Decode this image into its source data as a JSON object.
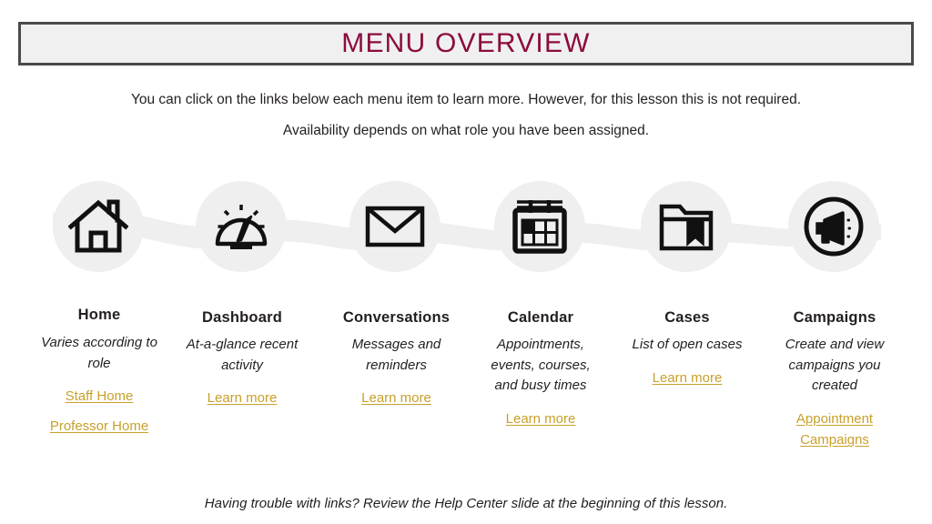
{
  "title": {
    "text": "MENU OVERVIEW",
    "color": "#8c0b3f",
    "banner_fill": "#f0f0f0",
    "banner_border": "#4a4a4a"
  },
  "intro": {
    "line1": "You can click on the links below each menu item to learn more. However, for this lesson this is not required.",
    "line2": "Availability depends on what role you have been assigned."
  },
  "icon_band": {
    "fill": "#efefef",
    "icons": [
      {
        "name": "home-icon"
      },
      {
        "name": "dashboard-gauge-icon"
      },
      {
        "name": "envelope-icon"
      },
      {
        "name": "calendar-icon"
      },
      {
        "name": "folder-bookmark-icon"
      },
      {
        "name": "megaphone-circle-icon"
      }
    ]
  },
  "columns": [
    {
      "id": "home",
      "title": "Home",
      "description": "Varies according to role",
      "links": [
        "Staff Home",
        "Professor Home"
      ]
    },
    {
      "id": "dashboard",
      "title": "Dashboard",
      "description": "At-a-glance recent activity",
      "links": [
        "Learn more"
      ]
    },
    {
      "id": "conversations",
      "title": "Conversations",
      "description": "Messages and reminders",
      "links": [
        "Learn more"
      ]
    },
    {
      "id": "calendar",
      "title": "Calendar",
      "description": "Appointments, events, courses, and busy times",
      "links": [
        "Learn more"
      ]
    },
    {
      "id": "cases",
      "title": "Cases",
      "description": "List of open cases",
      "links": [
        "Learn more"
      ]
    },
    {
      "id": "campaigns",
      "title": "Campaigns",
      "description": "Create and view campaigns you created",
      "links": [
        "Appointment Campaigns"
      ]
    }
  ],
  "footer": {
    "note": "Having trouble with links? Review the Help Center slide at the beginning of this lesson."
  },
  "link_color": "#c8a02a"
}
